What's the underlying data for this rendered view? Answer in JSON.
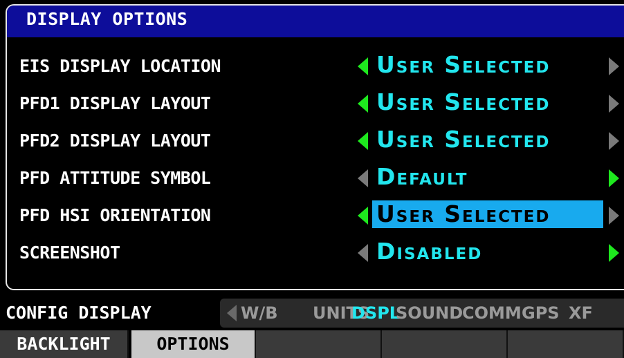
{
  "panel": {
    "title": "DISPLAY OPTIONS"
  },
  "rows": [
    {
      "label": "EIS DISPLAY LOCATION",
      "value": "User Selected",
      "left_active": true,
      "right_active": false,
      "selected": false
    },
    {
      "label": "PFD1 DISPLAY LAYOUT",
      "value": "User Selected",
      "left_active": true,
      "right_active": false,
      "selected": false
    },
    {
      "label": "PFD2 DISPLAY LAYOUT",
      "value": "User Selected",
      "left_active": true,
      "right_active": false,
      "selected": false
    },
    {
      "label": "PFD ATTITUDE SYMBOL",
      "value": "Default",
      "left_active": false,
      "right_active": true,
      "selected": false
    },
    {
      "label": "PFD HSI ORIENTATION",
      "value": "User Selected",
      "left_active": true,
      "right_active": false,
      "selected": true
    },
    {
      "label": "SCREENSHOT",
      "value": "Disabled",
      "left_active": false,
      "right_active": true,
      "selected": false
    }
  ],
  "pagebar": {
    "page_name": "CONFIG DISPLAY",
    "tabs": [
      "W/B",
      "UNITS",
      "DSPL",
      "SOUND",
      "COMM",
      "GPS",
      "XF"
    ],
    "active_tab": "DSPL"
  },
  "softkeys": [
    "BACKLIGHT",
    "OPTIONS",
    "",
    "",
    "",
    ""
  ],
  "active_softkey": "OPTIONS",
  "colors": {
    "accent": "#22e6ee",
    "arrow_active": "#1ee81e",
    "title_bg": "#0d0d9a",
    "selection_bg": "#18aaee"
  }
}
